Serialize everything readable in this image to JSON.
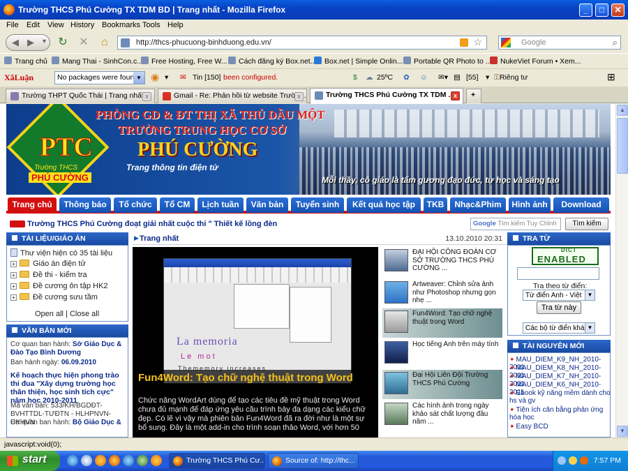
{
  "window": {
    "title": "Trường THCS Phú Cường TX TDM BD | Trang nhất - Mozilla Firefox",
    "minimize": "_",
    "maximize": "□",
    "close": "✕"
  },
  "menu": [
    "File",
    "Edit",
    "View",
    "History",
    "Bookmarks",
    "Tools",
    "Help"
  ],
  "nav": {
    "url": "http://thcs-phucuong-binhduong.edu.vn/",
    "search_placeholder": "Google",
    "icons": [
      "back-icon",
      "forward-icon",
      "reload-icon",
      "stop-icon",
      "home-icon",
      "rss-icon",
      "star-icon",
      "search-icon"
    ]
  },
  "bookmarks": [
    "Trang chủ",
    "Mang Thai - SinhCon.c...",
    "Free Hosting, Free W...",
    "Cách đăng ký Box.net...",
    "Box.net | Simple Onlin...",
    "Portable QR Photo to ...",
    "NukeViet Forum • Xem..."
  ],
  "addons": {
    "brand": "XãLuận",
    "package_select": "No packages were found,",
    "news_label": "Tin [150]",
    "status_text": "been configured.",
    "weather": "25ºC",
    "count": "[55]",
    "private_label": "Riêng tư"
  },
  "tabs": [
    {
      "label": "Trường THPT Quốc Thái | Trang nhất",
      "active": false
    },
    {
      "label": "Gmail - Re: Phản hồi từ website Trường...",
      "active": false
    },
    {
      "label": "Trường THCS Phú Cường TX TDM ...",
      "active": true
    }
  ],
  "new_tab": "+",
  "banner": {
    "line1": "PHÒNG GD & ĐT THỊ XÃ THỦ DẦU MỘT",
    "line2": "TRƯỜNG TRUNG HỌC CƠ SỞ",
    "line3": "PHÚ CƯỜNG",
    "line4": "Trang thông tin điện tử",
    "motto": "Mỗi thầy, cô giáo là tấm gương đạo đức, tự học và sáng tạo",
    "logo_text": "PTC",
    "logo_small": "Trường THCS",
    "logo_name": "PHÚ CƯỜNG"
  },
  "main_nav": [
    "Trang chủ",
    "Thông báo",
    "Tổ chức",
    "Tổ CM",
    "Lịch tuần",
    "Văn bản",
    "Tuyển sinh",
    "Kết quả học tập",
    "TKB",
    "Nhạc&Phim",
    "Hình ảnh",
    "Download"
  ],
  "news_ticker": "Trường THCS Phú Cường đoạt giải nhất cuộc thi \" Thiết kế lồng đèn",
  "site_search": {
    "placeholder": "Tìm kiếm Tuy Chỉnh",
    "brand": "Google",
    "button": "Tìm kiếm"
  },
  "left": {
    "docs_title": "TÀI LIỆU/GIÁO ÁN",
    "library": "Thư viện hiện có 35 tài liệu",
    "folders": [
      "Giáo án điện tử",
      "Đề thi - kiểm tra",
      "Đề cương ôn tập HK2",
      "Đề cương sưu tầm"
    ],
    "open_all": "Open all",
    "close_all": "Close all",
    "separator": "|",
    "newdocs_title": "VĂN BẢN MỚI",
    "doc1_agency_label": "Cơ quan ban hành:",
    "doc1_agency": "Sở Giáo Dục & Đào Tạo Bình Dương",
    "doc1_date_label": "Ban hành ngày:",
    "doc1_date": "06.09.2010",
    "doc2_title": "Kế hoạch thực hiện phong trào thi đua \"Xây dựng trường học thân thiện, học sinh tích cực\" năm học 2010-2011",
    "doc2_code_label": "Mã văn bản:",
    "doc2_code": "533/KH/BGDĐT-BVHTTDL-TƯĐTN - HLHPNVN-HKHVN",
    "doc2_agency_label": "Cơ quan ban hành:",
    "doc2_agency": "Bộ Giáo Dục &"
  },
  "center": {
    "breadcrumb": "Trang nhất",
    "date": "13.10.2010 20:31",
    "feature_title": "Fun4Word: Tạo chữ nghệ thuật trong Word",
    "feature_desc": "Chức năng WordArt dùng để tạo các tiêu đề mỹ thuật trong Word chưa đủ mạnh để đáp ứng yêu cầu trình bày đa dạng các kiểu chữ đẹp. Có lẽ vì vậy mà phiên bản Fun4Word đã ra đời như là một sự bổ sung. Đây là một add-in cho trình soạn thảo Word, với hơn 50",
    "screenshot_text1": "La memoria",
    "screenshot_text2": "Le mot",
    "screenshot_text3": "Thememory increases",
    "side_items": [
      "ĐẠI HỘI CÔNG ĐOÀN CƠ SỞ TRƯỜNG THCS PHÚ CƯỜNG ...",
      "Artweaver: Chỉnh sửa ảnh như Photoshop nhưng gọn nhẹ ...",
      "Fun4Word: Tạo chữ nghệ thuật trong Word",
      "Học tiếng Anh trên máy tính",
      "Đại Hội Liên Đội Trường THCS Phú Cường",
      "Các hình ảnh trong ngày khảo sát chất lượng đầu năm ..."
    ]
  },
  "right": {
    "dict_title": "TRA TỪ",
    "dict_logo_top": "DICT",
    "dict_logo_main": "ENABLED",
    "lookup_label": "Tra theo từ điển:",
    "dict_select": "Từ điển Anh - Việt",
    "lookup_button": "Tra từ này",
    "dict_set": "Các bộ từ điển khác",
    "resources_title": "TÀI NGUYÊN MỚI",
    "resources": [
      "MAU_DIEM_K9_NH_2010-2011",
      "MAU_DIEM_K8_NH_2010-2011",
      "MAU_DIEM_K7_NH_2010-2011",
      "MAU_DIEM_K6_NH_2010-2011",
      "Ebook kỹ năng mềm dành cho hs và gv",
      "Tiện ích cân bằng phản ứng hóa học",
      "Easy BCD"
    ]
  },
  "status": "javascript:void(0);",
  "taskbar": {
    "start": "start",
    "items": [
      "Trường THCS Phú Cư...",
      "Source of: http://thc..."
    ],
    "clock": "7:57 PM"
  }
}
